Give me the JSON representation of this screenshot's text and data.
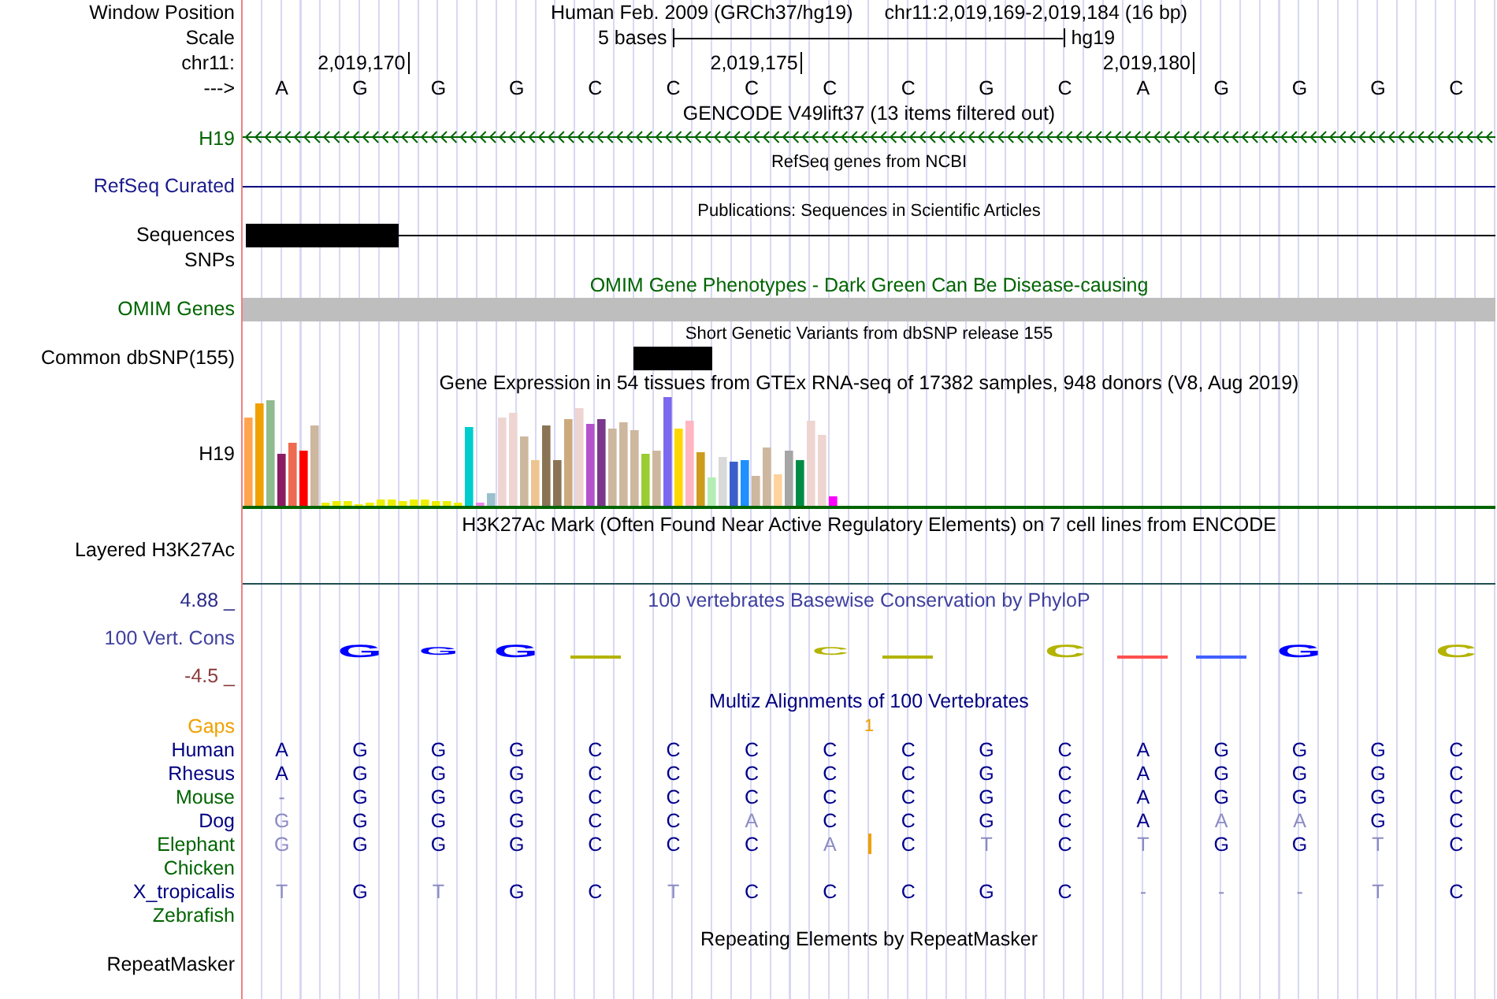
{
  "header": {
    "label": "Window Position",
    "assembly": "Human Feb. 2009 (GRCh37/hg19)",
    "position": "chr11:2,019,169-2,019,184 (16 bp)"
  },
  "scale": {
    "label": "Scale",
    "span": "5 bases",
    "db": "hg19"
  },
  "ruler": {
    "label": "chr11:",
    "ticks": [
      "2,019,170",
      "2,019,175",
      "2,019,180"
    ]
  },
  "sequence": {
    "label": "--->",
    "bases": [
      "A",
      "G",
      "G",
      "G",
      "C",
      "C",
      "C",
      "C",
      "C",
      "G",
      "C",
      "A",
      "G",
      "G",
      "G",
      "C"
    ]
  },
  "gencode": {
    "title": "GENCODE V49lift37 (13 items filtered out)",
    "gene": "H19"
  },
  "refseq": {
    "title": "RefSeq genes from NCBI",
    "label": "RefSeq Curated"
  },
  "publications": {
    "title": "Publications: Sequences in Scientific Articles",
    "label": "Sequences"
  },
  "snps": {
    "label": "SNPs"
  },
  "omim": {
    "title": "OMIM Gene Phenotypes - Dark Green Can Be Disease-causing",
    "label": "OMIM Genes"
  },
  "dbsnp": {
    "title": "Short Genetic Variants from dbSNP release 155",
    "label": "Common dbSNP(155)"
  },
  "gtex": {
    "title": "Gene Expression in 54 tissues from GTEx RNA-seq of 17382 samples, 948 donors (V8, Aug 2019)",
    "gene": "H19"
  },
  "h3k27ac": {
    "title": "H3K27Ac Mark (Often Found Near Active Regulatory Elements) on 7 cell lines from ENCODE",
    "label": "Layered H3K27Ac"
  },
  "conservation": {
    "title": "100 vertebrates Basewise Conservation by PhyloP",
    "label": "100 Vert. Cons",
    "max": "4.88 _",
    "min": "-4.5 _",
    "logo": [
      {
        "kind": "none"
      },
      {
        "kind": "big",
        "letter": "G",
        "color": "#0000ff"
      },
      {
        "kind": "small",
        "letter": "G",
        "color": "#0000ff"
      },
      {
        "kind": "big",
        "letter": "G",
        "color": "#0000ff"
      },
      {
        "kind": "flat",
        "color": "#b3b300"
      },
      {
        "kind": "none"
      },
      {
        "kind": "none"
      },
      {
        "kind": "small",
        "letter": "C",
        "color": "#b3b300"
      },
      {
        "kind": "flat",
        "color": "#b3b300"
      },
      {
        "kind": "none"
      },
      {
        "kind": "big",
        "letter": "C",
        "color": "#b3b300"
      },
      {
        "kind": "flat",
        "color": "#ff5050"
      },
      {
        "kind": "flat",
        "color": "#4060ff"
      },
      {
        "kind": "big",
        "letter": "G",
        "color": "#0000ff"
      },
      {
        "kind": "none"
      },
      {
        "kind": "big",
        "letter": "C",
        "color": "#b3b300"
      }
    ]
  },
  "multiz": {
    "title": "Multiz Alignments of 100 Vertebrates",
    "gaps": {
      "label": "Gaps",
      "items": [
        {
          "kind": "space"
        },
        {
          "kind": "space"
        },
        {
          "kind": "space"
        },
        {
          "kind": "space"
        },
        {
          "kind": "space"
        },
        {
          "kind": "space"
        },
        {
          "kind": "space"
        },
        {
          "kind": "space"
        },
        {
          "kind": "count",
          "text": "1"
        }
      ]
    },
    "species": [
      {
        "name": "Human",
        "color": "#000080",
        "bases": [
          {
            "kind": "base",
            "text": "A",
            "faint": false
          },
          {
            "kind": "base",
            "text": "G",
            "faint": false
          },
          {
            "kind": "base",
            "text": "G",
            "faint": false
          },
          {
            "kind": "base",
            "text": "G",
            "faint": false
          },
          {
            "kind": "base",
            "text": "C",
            "faint": false
          },
          {
            "kind": "base",
            "text": "C",
            "faint": false
          },
          {
            "kind": "base",
            "text": "C",
            "faint": false
          },
          {
            "kind": "base",
            "text": "C",
            "faint": false
          },
          {
            "kind": "base",
            "text": "C",
            "faint": false
          },
          {
            "kind": "base",
            "text": "G",
            "faint": false
          },
          {
            "kind": "base",
            "text": "C",
            "faint": false
          },
          {
            "kind": "base",
            "text": "A",
            "faint": false
          },
          {
            "kind": "base",
            "text": "G",
            "faint": false
          },
          {
            "kind": "base",
            "text": "G",
            "faint": false
          },
          {
            "kind": "base",
            "text": "G",
            "faint": false
          },
          {
            "kind": "base",
            "text": "C",
            "faint": false
          }
        ]
      },
      {
        "name": "Rhesus",
        "color": "#000080",
        "bases": [
          {
            "kind": "base",
            "text": "A",
            "faint": false
          },
          {
            "kind": "base",
            "text": "G",
            "faint": false
          },
          {
            "kind": "base",
            "text": "G",
            "faint": false
          },
          {
            "kind": "base",
            "text": "G",
            "faint": false
          },
          {
            "kind": "base",
            "text": "C",
            "faint": false
          },
          {
            "kind": "base",
            "text": "C",
            "faint": false
          },
          {
            "kind": "base",
            "text": "C",
            "faint": false
          },
          {
            "kind": "base",
            "text": "C",
            "faint": false
          },
          {
            "kind": "base",
            "text": "C",
            "faint": false
          },
          {
            "kind": "base",
            "text": "G",
            "faint": false
          },
          {
            "kind": "base",
            "text": "C",
            "faint": false
          },
          {
            "kind": "base",
            "text": "A",
            "faint": false
          },
          {
            "kind": "base",
            "text": "G",
            "faint": false
          },
          {
            "kind": "base",
            "text": "G",
            "faint": false
          },
          {
            "kind": "base",
            "text": "G",
            "faint": false
          },
          {
            "kind": "base",
            "text": "C",
            "faint": false
          }
        ]
      },
      {
        "name": "Mouse",
        "color": "#006400",
        "bases": [
          {
            "kind": "base",
            "text": "-",
            "faint": true
          },
          {
            "kind": "base",
            "text": "G",
            "faint": false
          },
          {
            "kind": "base",
            "text": "G",
            "faint": false
          },
          {
            "kind": "base",
            "text": "G",
            "faint": false
          },
          {
            "kind": "base",
            "text": "C",
            "faint": false
          },
          {
            "kind": "base",
            "text": "C",
            "faint": false
          },
          {
            "kind": "base",
            "text": "C",
            "faint": false
          },
          {
            "kind": "base",
            "text": "C",
            "faint": false
          },
          {
            "kind": "base",
            "text": "C",
            "faint": false
          },
          {
            "kind": "base",
            "text": "G",
            "faint": false
          },
          {
            "kind": "base",
            "text": "C",
            "faint": false
          },
          {
            "kind": "base",
            "text": "A",
            "faint": false
          },
          {
            "kind": "base",
            "text": "G",
            "faint": false
          },
          {
            "kind": "base",
            "text": "G",
            "faint": false
          },
          {
            "kind": "base",
            "text": "G",
            "faint": false
          },
          {
            "kind": "base",
            "text": "C",
            "faint": false
          }
        ]
      },
      {
        "name": "Dog",
        "color": "#000080",
        "bases": [
          {
            "kind": "base",
            "text": "G",
            "faint": true
          },
          {
            "kind": "base",
            "text": "G",
            "faint": false
          },
          {
            "kind": "base",
            "text": "G",
            "faint": false
          },
          {
            "kind": "base",
            "text": "G",
            "faint": false
          },
          {
            "kind": "base",
            "text": "C",
            "faint": false
          },
          {
            "kind": "base",
            "text": "C",
            "faint": false
          },
          {
            "kind": "base",
            "text": "A",
            "faint": true
          },
          {
            "kind": "base",
            "text": "C",
            "faint": false
          },
          {
            "kind": "base",
            "text": "C",
            "faint": false
          },
          {
            "kind": "base",
            "text": "G",
            "faint": false
          },
          {
            "kind": "base",
            "text": "C",
            "faint": false
          },
          {
            "kind": "base",
            "text": "A",
            "faint": false
          },
          {
            "kind": "base",
            "text": "A",
            "faint": true
          },
          {
            "kind": "base",
            "text": "A",
            "faint": true
          },
          {
            "kind": "base",
            "text": "G",
            "faint": false
          },
          {
            "kind": "base",
            "text": "C",
            "faint": false
          }
        ]
      },
      {
        "name": "Elephant",
        "color": "#006400",
        "bases": [
          {
            "kind": "base",
            "text": "G",
            "faint": true
          },
          {
            "kind": "base",
            "text": "G",
            "faint": false
          },
          {
            "kind": "base",
            "text": "G",
            "faint": false
          },
          {
            "kind": "base",
            "text": "G",
            "faint": false
          },
          {
            "kind": "base",
            "text": "C",
            "faint": false
          },
          {
            "kind": "base",
            "text": "C",
            "faint": false
          },
          {
            "kind": "base",
            "text": "C",
            "faint": false
          },
          {
            "kind": "base",
            "text": "A",
            "faint": true
          },
          {
            "kind": "insert"
          },
          {
            "kind": "base",
            "text": "C",
            "faint": false
          },
          {
            "kind": "base",
            "text": "T",
            "faint": true
          },
          {
            "kind": "base",
            "text": "C",
            "faint": false
          },
          {
            "kind": "base",
            "text": "T",
            "faint": true
          },
          {
            "kind": "base",
            "text": "G",
            "faint": false
          },
          {
            "kind": "base",
            "text": "G",
            "faint": false
          },
          {
            "kind": "base",
            "text": "T",
            "faint": true
          },
          {
            "kind": "base",
            "text": "C",
            "faint": false
          }
        ]
      },
      {
        "name": "Chicken",
        "color": "#006400"
      },
      {
        "name": "X_tropicalis",
        "color": "#000080",
        "bases": [
          {
            "kind": "base",
            "text": "T",
            "faint": true
          },
          {
            "kind": "base",
            "text": "G",
            "faint": false
          },
          {
            "kind": "base",
            "text": "T",
            "faint": true
          },
          {
            "kind": "base",
            "text": "G",
            "faint": false
          },
          {
            "kind": "base",
            "text": "C",
            "faint": false
          },
          {
            "kind": "base",
            "text": "T",
            "faint": true
          },
          {
            "kind": "base",
            "text": "C",
            "faint": false
          },
          {
            "kind": "base",
            "text": "C",
            "faint": false
          },
          {
            "kind": "base",
            "text": "C",
            "faint": false
          },
          {
            "kind": "base",
            "text": "G",
            "faint": false
          },
          {
            "kind": "base",
            "text": "C",
            "faint": false
          },
          {
            "kind": "base",
            "text": "-",
            "faint": true
          },
          {
            "kind": "base",
            "text": "-",
            "faint": true
          },
          {
            "kind": "base",
            "text": "-",
            "faint": true
          },
          {
            "kind": "base",
            "text": "T",
            "faint": true
          },
          {
            "kind": "base",
            "text": "C",
            "faint": false
          }
        ]
      },
      {
        "name": "Zebrafish",
        "color": "#006400"
      }
    ]
  },
  "repeatmasker": {
    "title": "Repeating Elements by RepeatMasker",
    "label": "RepeatMasker"
  }
}
